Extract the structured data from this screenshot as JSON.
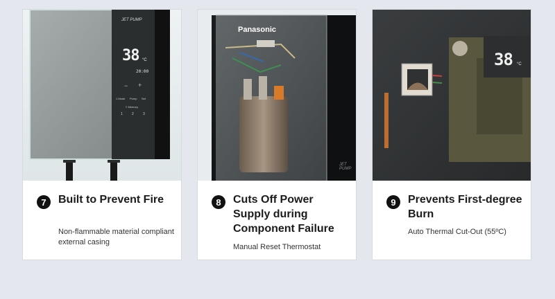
{
  "cards": [
    {
      "number": "7",
      "title": "Built to Prevent Fire",
      "description": "Non-flammable material compliant external casing",
      "device": {
        "model_label": "JET PUMP",
        "temperature": "38",
        "unit": "°C",
        "time": "20:00",
        "buttons": [
          "1 Mode",
          "Pump",
          "Set"
        ],
        "memory_label": "≡ Memory",
        "memory_slots": [
          "1",
          "2",
          "3"
        ]
      }
    },
    {
      "number": "8",
      "title": "Cuts Off Power Supply during Component Failure",
      "description": "Manual Reset Thermostat",
      "device": {
        "brand": "Panasonic",
        "model_label": "JET PUMP"
      }
    },
    {
      "number": "9",
      "title": "Prevents First-degree Burn",
      "description": "Auto Thermal Cut-Out (55ºC)",
      "device": {
        "temperature": "38",
        "unit": "°C"
      }
    }
  ],
  "colors": {
    "page_bg": "#e4e8ee",
    "card_bg": "#ffffff",
    "badge_bg": "#111111"
  }
}
